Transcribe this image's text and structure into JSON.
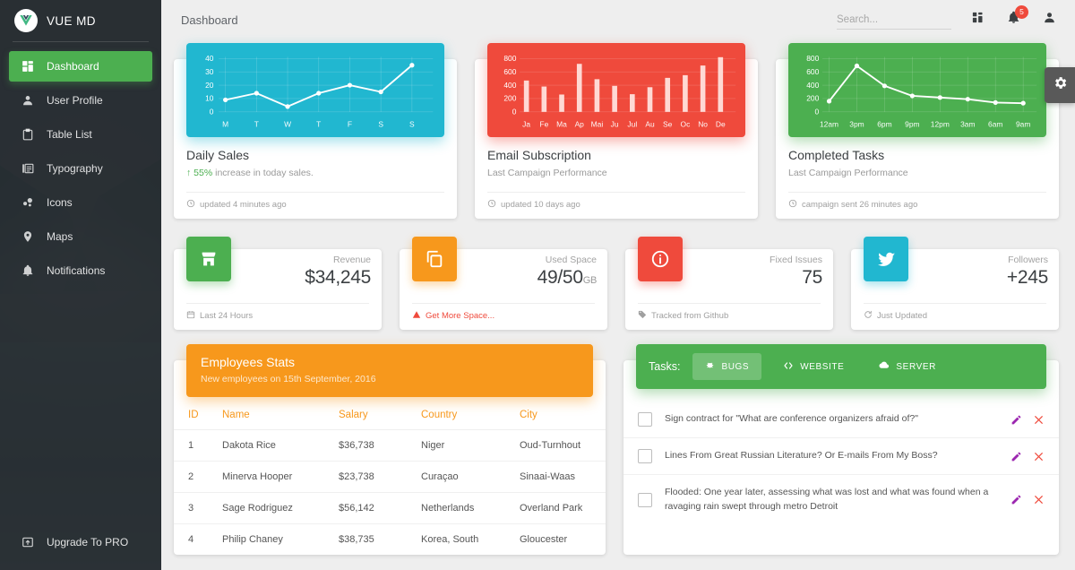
{
  "sidebar": {
    "brand": "VUE MD",
    "items": [
      {
        "label": "Dashboard",
        "icon": "dashboard-icon",
        "active": true
      },
      {
        "label": "User Profile",
        "icon": "user-icon",
        "active": false
      },
      {
        "label": "Table List",
        "icon": "clipboard-icon",
        "active": false
      },
      {
        "label": "Typography",
        "icon": "typography-icon",
        "active": false
      },
      {
        "label": "Icons",
        "icon": "bubble-chart-icon",
        "active": false
      },
      {
        "label": "Maps",
        "icon": "map-pin-icon",
        "active": false
      },
      {
        "label": "Notifications",
        "icon": "bell-icon",
        "active": false
      }
    ],
    "footer": {
      "label": "Upgrade To PRO",
      "icon": "unarchive-icon"
    }
  },
  "topbar": {
    "title": "Dashboard",
    "search_placeholder": "Search...",
    "search_value": "",
    "icons": {
      "apps": "dashboard-grid-icon",
      "notifications": "bell-icon",
      "person": "person-icon"
    },
    "notification_count": "5"
  },
  "settings_tab": {
    "icon": "gear-icon"
  },
  "charts": [
    {
      "accent": "#21b7d0",
      "title": "Daily Sales",
      "subtitle_highlight": "55%",
      "subtitle_rest": "increase in today sales.",
      "footer": "updated 4 minutes ago",
      "footer_icon": "clock-icon"
    },
    {
      "accent": "#ef4a3c",
      "title": "Email Subscription",
      "subtitle_rest": "Last Campaign Performance",
      "footer": "updated 10 days ago",
      "footer_icon": "clock-icon"
    },
    {
      "accent": "#4caf50",
      "title": "Completed Tasks",
      "subtitle_rest": "Last Campaign Performance",
      "footer": "campaign sent 26 minutes ago",
      "footer_icon": "clock-icon"
    }
  ],
  "chart_data": [
    {
      "type": "line",
      "title": "Daily Sales",
      "categories": [
        "M",
        "T",
        "W",
        "T",
        "F",
        "S",
        "S"
      ],
      "values": [
        9,
        14,
        4,
        14,
        20,
        15,
        35
      ],
      "yticks": [
        0,
        10,
        20,
        30,
        40
      ],
      "ylim": [
        0,
        45
      ],
      "xlabel": "",
      "ylabel": "",
      "grid": true,
      "legend": "none",
      "color": "#ffffff",
      "background": "#21b7d0"
    },
    {
      "type": "bar",
      "title": "Email Subscription",
      "categories": [
        "Ja",
        "Fe",
        "Ma",
        "Ap",
        "Mai",
        "Ju",
        "Jul",
        "Au",
        "Se",
        "Oc",
        "No",
        "De"
      ],
      "values": [
        470,
        380,
        260,
        720,
        490,
        390,
        265,
        370,
        510,
        550,
        695,
        820
      ],
      "yticks": [
        0,
        200,
        400,
        600,
        800
      ],
      "ylim": [
        0,
        900
      ],
      "xlabel": "",
      "ylabel": "",
      "grid": true,
      "legend": "none",
      "color": "#ffd9d4",
      "background": "#ef4a3c"
    },
    {
      "type": "line",
      "title": "Completed Tasks",
      "categories": [
        "12am",
        "3pm",
        "6pm",
        "9pm",
        "12pm",
        "3am",
        "6am",
        "9am"
      ],
      "values": [
        160,
        690,
        390,
        240,
        215,
        190,
        140,
        130
      ],
      "yticks": [
        0,
        200,
        400,
        600,
        800
      ],
      "ylim": [
        0,
        880
      ],
      "xlabel": "",
      "ylabel": "",
      "grid": true,
      "legend": "none",
      "color": "#ffffff",
      "background": "#4caf50"
    }
  ],
  "stats": [
    {
      "icon": "store-icon",
      "icon_color": "green",
      "label": "Revenue",
      "value": "$34,245",
      "unit": "",
      "footer": "Last 24 Hours",
      "footer_icon": "calendar-icon",
      "footer_link": false
    },
    {
      "icon": "copy-icon",
      "icon_color": "orange",
      "label": "Used Space",
      "value": "49/50",
      "unit": "GB",
      "footer": "Get More Space...",
      "footer_icon": "warning-icon",
      "footer_link": true
    },
    {
      "icon": "info-icon",
      "icon_color": "red",
      "label": "Fixed Issues",
      "value": "75",
      "unit": "",
      "footer": "Tracked from Github",
      "footer_icon": "tag-icon",
      "footer_link": false
    },
    {
      "icon": "twitter-icon",
      "icon_color": "cyan",
      "label": "Followers",
      "value": "+245",
      "unit": "",
      "footer": "Just Updated",
      "footer_icon": "update-icon",
      "footer_link": false
    }
  ],
  "employees": {
    "title": "Employees Stats",
    "subtitle": "New employees on 15th September, 2016",
    "columns": [
      "ID",
      "Name",
      "Salary",
      "Country",
      "City"
    ],
    "rows": [
      [
        "1",
        "Dakota Rice",
        "$36,738",
        "Niger",
        "Oud-Turnhout"
      ],
      [
        "2",
        "Minerva Hooper",
        "$23,738",
        "Curaçao",
        "Sinaai-Waas"
      ],
      [
        "3",
        "Sage Rodriguez",
        "$56,142",
        "Netherlands",
        "Overland Park"
      ],
      [
        "4",
        "Philip Chaney",
        "$38,735",
        "Korea, South",
        "Gloucester"
      ]
    ]
  },
  "tasks": {
    "header_label": "Tasks:",
    "tabs": [
      {
        "label": "BUGS",
        "icon": "bug-icon",
        "active": true
      },
      {
        "label": "WEBSITE",
        "icon": "code-icon",
        "active": false
      },
      {
        "label": "SERVER",
        "icon": "cloud-icon",
        "active": false
      }
    ],
    "rows": [
      {
        "text": "Sign contract for \"What are conference organizers afraid of?\"",
        "checked": false
      },
      {
        "text": "Lines From Great Russian Literature? Or E-mails From My Boss?",
        "checked": false
      },
      {
        "text": "Flooded: One year later, assessing what was lost and what was found when a ravaging rain swept through metro Detroit",
        "checked": false
      }
    ],
    "edit_icon": "pencil-icon",
    "delete_icon": "close-icon",
    "edit_color": "#9c27b0",
    "delete_color": "#ef4a3c"
  }
}
